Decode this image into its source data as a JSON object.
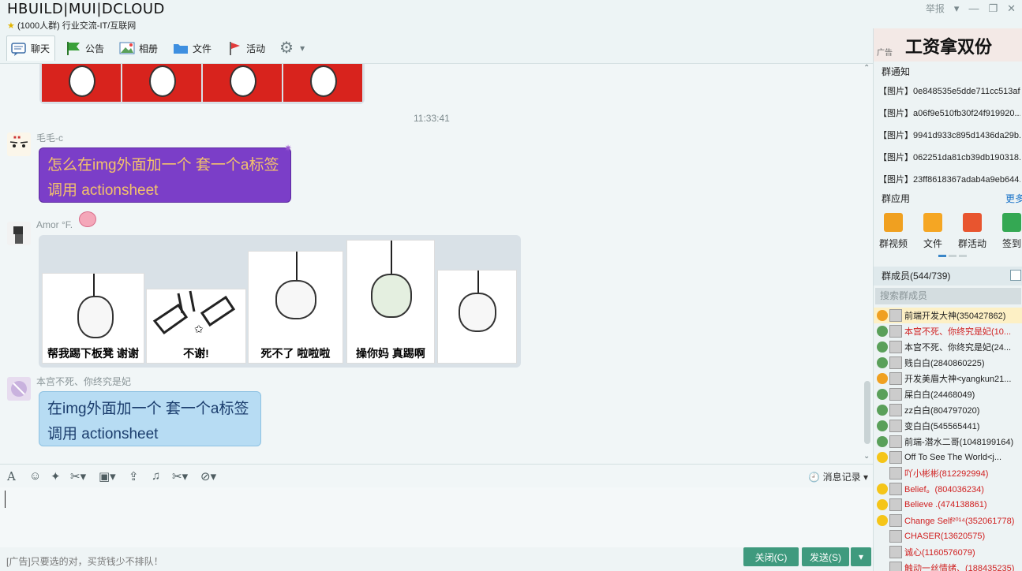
{
  "window": {
    "title": "HBUILD|MUI|DCLOUD",
    "subtitle": "(1000人群) 行业交流-IT/互联网",
    "report": "举报"
  },
  "tabs": [
    {
      "label": "聊天",
      "icon": "chat-icon"
    },
    {
      "label": "公告",
      "icon": "flag-icon"
    },
    {
      "label": "相册",
      "icon": "photo-icon"
    },
    {
      "label": "文件",
      "icon": "folder-icon"
    },
    {
      "label": "活动",
      "icon": "pennant-icon"
    },
    {
      "label": "",
      "icon": "gear-icon"
    }
  ],
  "chat": {
    "timestamp": "11:33:41",
    "messages": [
      {
        "sender": "毛毛-c",
        "lines": [
          "怎么在img外面加一个 套一个a标签",
          "调用 actionsheet"
        ]
      },
      {
        "sender": "Amor °F.",
        "stickers": [
          "帮我踢下板凳  谢谢",
          "不谢!",
          "死不了  啦啦啦",
          "操你妈 真踢啊",
          ""
        ]
      },
      {
        "sender": "本宫不死、你终究是妃",
        "lines": [
          "在img外面加一个 套一个a标签",
          "调用 actionsheet"
        ]
      }
    ]
  },
  "toolbar": {
    "history": "消息记录"
  },
  "footer": {
    "ad": "[广告]只要选的对，买货钱少不排队！",
    "close": "关闭(C)",
    "send": "发送(S)"
  },
  "right": {
    "ad_tag": "广告",
    "ad_text": "工资拿双份",
    "notice_title": "群通知",
    "notices": [
      "【图片】0e848535e5dde711cc513af...",
      "【图片】a06f9e510fb30f24f919920...",
      "【图片】9941d933c895d1436da29b...",
      "【图片】062251da81cb39db190318...",
      "【图片】23ff8618367adab4a9eb644..."
    ],
    "apps_title": "群应用",
    "apps_more": "更多",
    "apps": [
      {
        "label": "群视频",
        "color": "#f0a020"
      },
      {
        "label": "文件",
        "color": "#f5a623"
      },
      {
        "label": "群活动",
        "color": "#e8552f"
      },
      {
        "label": "签到",
        "color": "#34a853"
      }
    ],
    "members_title": "群成员(544/739)",
    "search_placeholder": "搜索群成员",
    "members": [
      {
        "name": "前端开发大神(350427862)",
        "color": "#222",
        "role": "#f0a020"
      },
      {
        "name": "本宫不死、你终究是妃(10...",
        "color": "#d02020",
        "role": "#5aa05a"
      },
      {
        "name": "本宫不死、你终究是妃(24...",
        "color": "#222",
        "role": "#5aa05a"
      },
      {
        "name": "贱白白(2840860225)",
        "color": "#222",
        "role": "#5aa05a"
      },
      {
        "name": "开发美眉大神<yangkun21...",
        "color": "#222",
        "role": "#f0a020"
      },
      {
        "name": "屎白白(24468049)",
        "color": "#222",
        "role": "#5aa05a"
      },
      {
        "name": "zz白白(804797020)",
        "color": "#222",
        "role": "#5aa05a"
      },
      {
        "name": "变白白(545565441)",
        "color": "#222",
        "role": "#5aa05a"
      },
      {
        "name": "前端-潜水二哥(1048199164)",
        "color": "#222",
        "role": "#5aa05a"
      },
      {
        "name": "Off To See The World<j...",
        "color": "#222",
        "role": "#f5c518"
      },
      {
        "name": "吖小彬彬(812292994)",
        "color": "#d02020",
        "role": ""
      },
      {
        "name": "Belief。(804036234)",
        "color": "#d02020",
        "role": "#f5c518"
      },
      {
        "name": "Believe .(474138861)",
        "color": "#d02020",
        "role": "#f5c518"
      },
      {
        "name": "Change Self²⁰¹⁴(352061778)",
        "color": "#d02020",
        "role": "#f5c518"
      },
      {
        "name": "CHASER(13620575)",
        "color": "#d02020",
        "role": ""
      },
      {
        "name": "诚心(1160576079)",
        "color": "#d02020",
        "role": ""
      },
      {
        "name": "触动一丝情绪、(188435235)",
        "color": "#d02020",
        "role": ""
      }
    ]
  }
}
